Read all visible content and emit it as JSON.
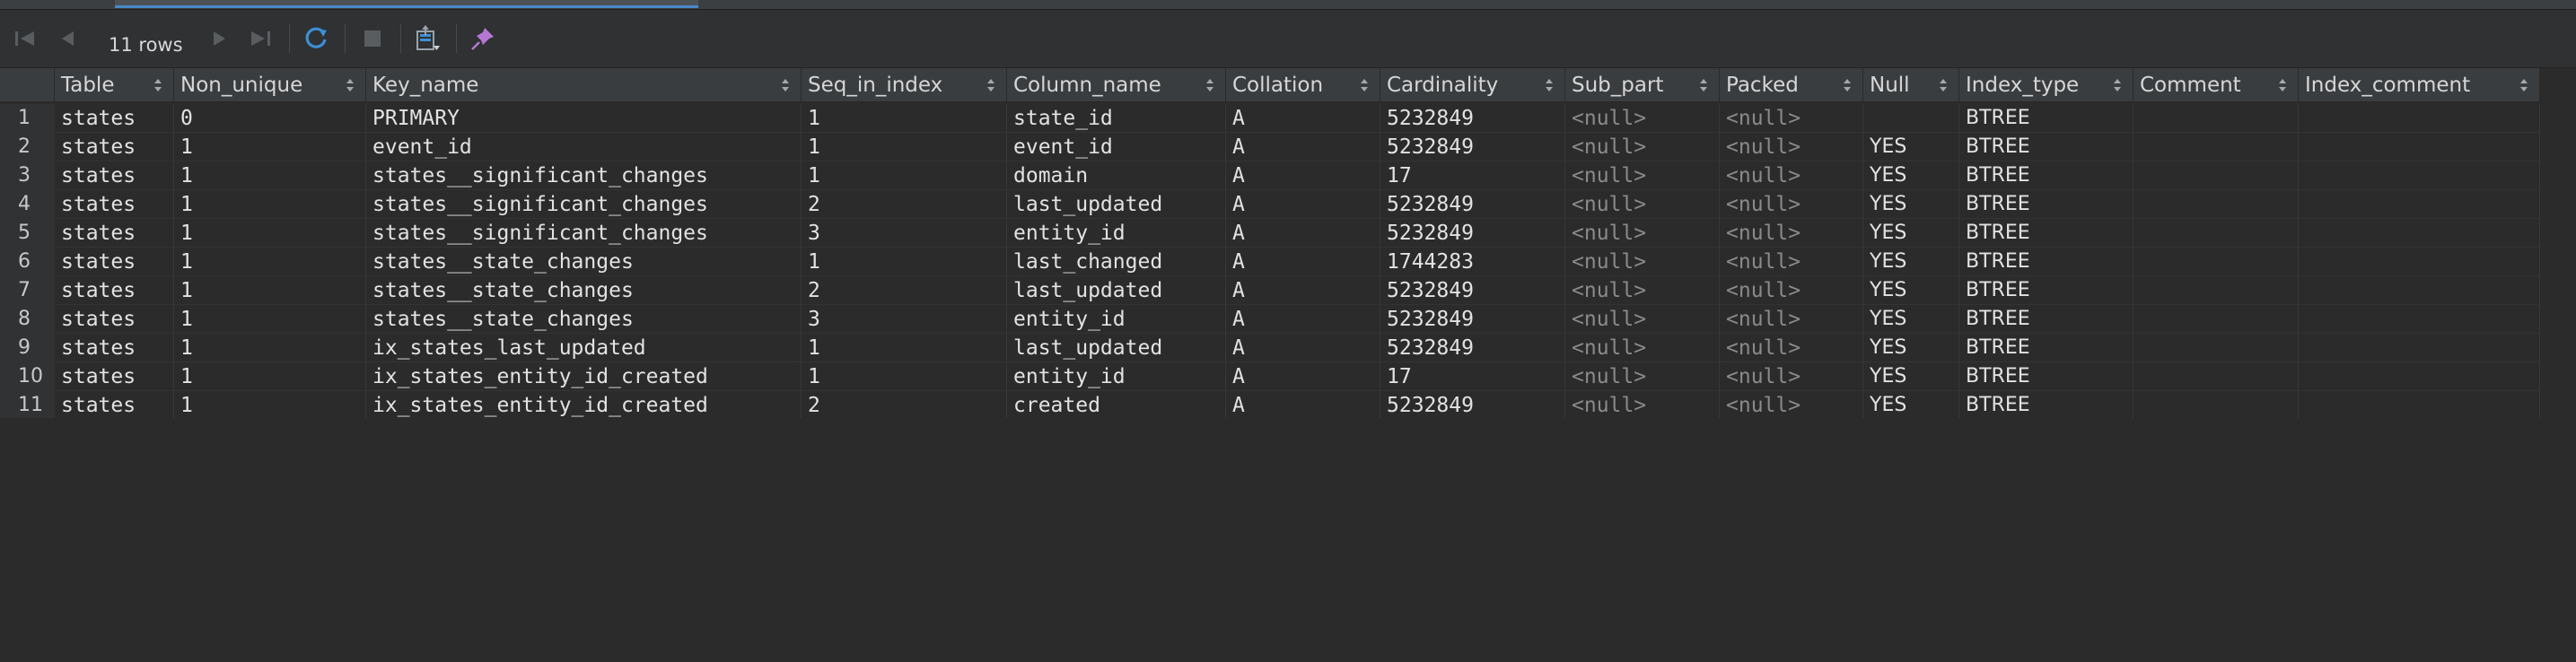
{
  "toolbar": {
    "rows_label": "11 rows",
    "icons": [
      "first-page-icon",
      "prev-page-icon",
      "next-page-icon",
      "last-page-icon",
      "refresh-icon",
      "stop-icon",
      "export-icon",
      "pin-icon"
    ]
  },
  "table": {
    "columns": [
      "Table",
      "Non_unique",
      "Key_name",
      "Seq_in_index",
      "Column_name",
      "Collation",
      "Cardinality",
      "Sub_part",
      "Packed",
      "Null",
      "Index_type",
      "Comment",
      "Index_comment"
    ],
    "rows": [
      {
        "num": "1",
        "cells": [
          "states",
          "0",
          "PRIMARY",
          "1",
          "state_id",
          "A",
          "5232849",
          "<null>",
          "<null>",
          "",
          "BTREE",
          "",
          ""
        ]
      },
      {
        "num": "2",
        "cells": [
          "states",
          "1",
          "event_id",
          "1",
          "event_id",
          "A",
          "5232849",
          "<null>",
          "<null>",
          "YES",
          "BTREE",
          "",
          ""
        ]
      },
      {
        "num": "3",
        "cells": [
          "states",
          "1",
          "states__significant_changes",
          "1",
          "domain",
          "A",
          "17",
          "<null>",
          "<null>",
          "YES",
          "BTREE",
          "",
          ""
        ]
      },
      {
        "num": "4",
        "cells": [
          "states",
          "1",
          "states__significant_changes",
          "2",
          "last_updated",
          "A",
          "5232849",
          "<null>",
          "<null>",
          "YES",
          "BTREE",
          "",
          ""
        ]
      },
      {
        "num": "5",
        "cells": [
          "states",
          "1",
          "states__significant_changes",
          "3",
          "entity_id",
          "A",
          "5232849",
          "<null>",
          "<null>",
          "YES",
          "BTREE",
          "",
          ""
        ]
      },
      {
        "num": "6",
        "cells": [
          "states",
          "1",
          "states__state_changes",
          "1",
          "last_changed",
          "A",
          "1744283",
          "<null>",
          "<null>",
          "YES",
          "BTREE",
          "",
          ""
        ]
      },
      {
        "num": "7",
        "cells": [
          "states",
          "1",
          "states__state_changes",
          "2",
          "last_updated",
          "A",
          "5232849",
          "<null>",
          "<null>",
          "YES",
          "BTREE",
          "",
          ""
        ]
      },
      {
        "num": "8",
        "cells": [
          "states",
          "1",
          "states__state_changes",
          "3",
          "entity_id",
          "A",
          "5232849",
          "<null>",
          "<null>",
          "YES",
          "BTREE",
          "",
          ""
        ]
      },
      {
        "num": "9",
        "cells": [
          "states",
          "1",
          "ix_states_last_updated",
          "1",
          "last_updated",
          "A",
          "5232849",
          "<null>",
          "<null>",
          "YES",
          "BTREE",
          "",
          ""
        ]
      },
      {
        "num": "10",
        "cells": [
          "states",
          "1",
          "ix_states_entity_id_created",
          "1",
          "entity_id",
          "A",
          "17",
          "<null>",
          "<null>",
          "YES",
          "BTREE",
          "",
          ""
        ]
      },
      {
        "num": "11",
        "cells": [
          "states",
          "1",
          "ix_states_entity_id_created",
          "2",
          "created",
          "A",
          "5232849",
          "<null>",
          "<null>",
          "YES",
          "BTREE",
          "",
          ""
        ]
      }
    ]
  }
}
